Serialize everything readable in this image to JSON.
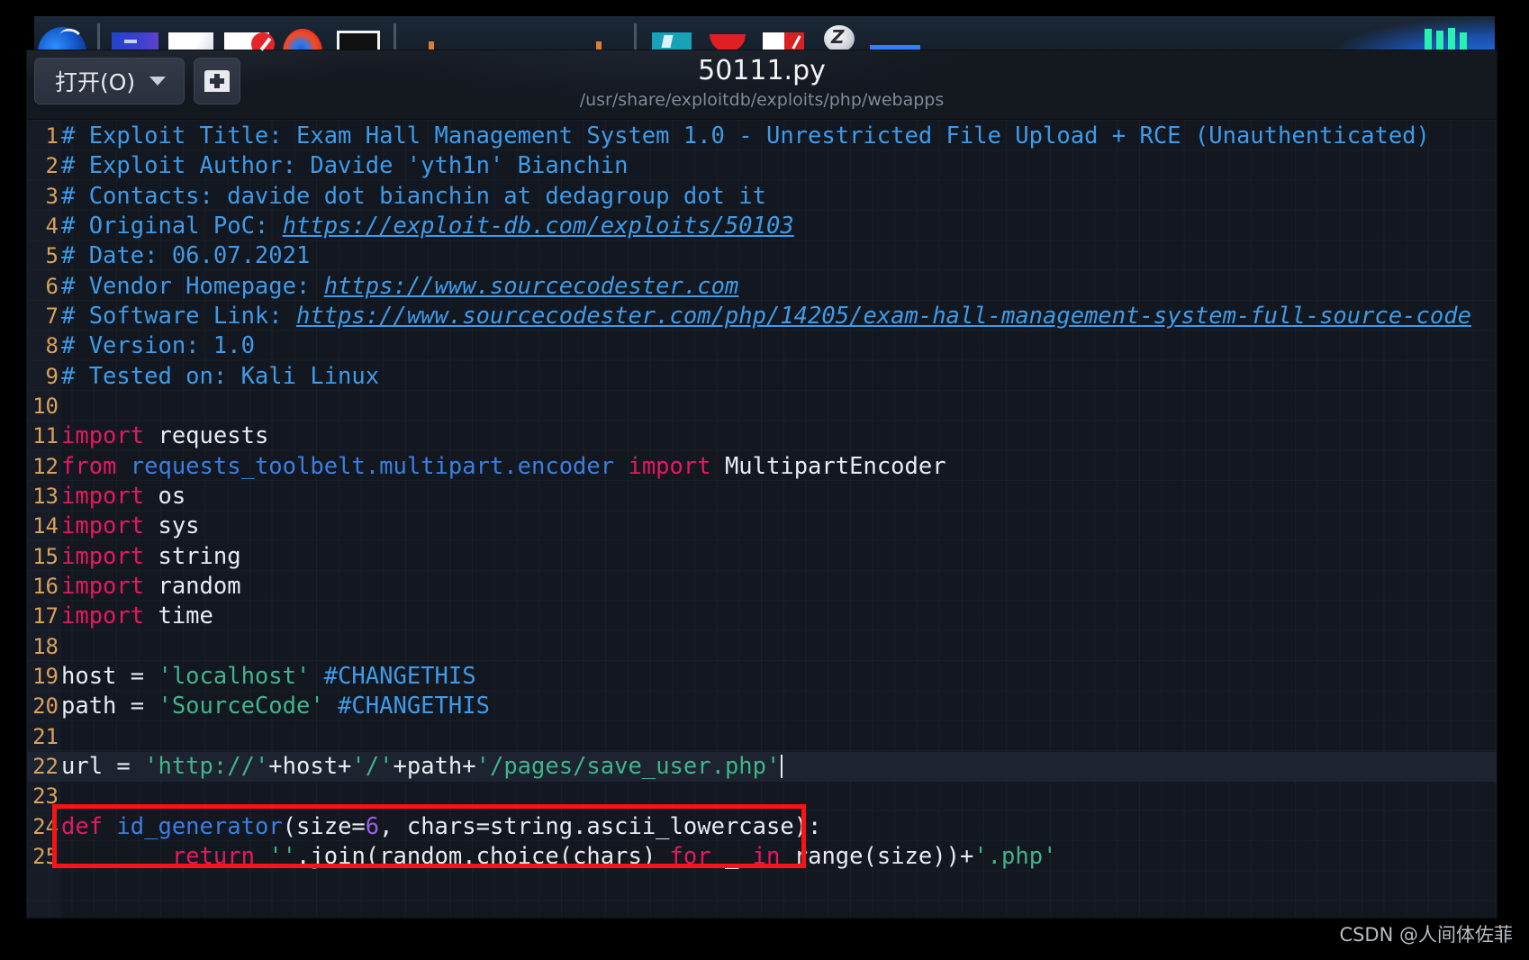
{
  "window": {
    "doc_title": "50111.py",
    "doc_path": "/usr/share/exploitdb/exploits/php/webapps"
  },
  "toolbar": {
    "open_label": "打开(O)",
    "open_icon": "chevron-down-icon",
    "newtab_icon": "new-document-icon"
  },
  "dock": {
    "items": [
      {
        "icon": "kali-menu-icon"
      },
      {
        "icon": "terminal-icon"
      },
      {
        "icon": "file-manager-icon"
      },
      {
        "icon": "text-editor-icon"
      },
      {
        "icon": "firefox-icon"
      },
      {
        "icon": "terminal-window-icon"
      },
      {
        "icon": "workspace-1-icon"
      },
      {
        "icon": "workspace-2-icon"
      },
      {
        "icon": "workspace-3-icon"
      },
      {
        "icon": "workspace-4-icon"
      },
      {
        "icon": "burp-suite-icon"
      },
      {
        "icon": "red-app-icon"
      },
      {
        "icon": "pdf-reader-icon"
      },
      {
        "icon": "zoom-icon"
      },
      {
        "icon": "blue-bar-icon"
      },
      {
        "icon": "cpu-monitor-icon"
      }
    ]
  },
  "editor": {
    "current_line": 22,
    "cursor_line": 22,
    "lines": [
      {
        "n": "1",
        "tokens": [
          {
            "t": "comment",
            "v": "# Exploit Title: Exam Hall Management System 1.0 - Unrestricted File Upload + RCE (Unauthenticated)"
          }
        ]
      },
      {
        "n": "2",
        "tokens": [
          {
            "t": "comment",
            "v": "# Exploit Author: Davide 'yth1n' Bianchin"
          }
        ]
      },
      {
        "n": "3",
        "tokens": [
          {
            "t": "comment",
            "v": "# Contacts: davide dot bianchin at dedagroup dot it"
          }
        ]
      },
      {
        "n": "4",
        "tokens": [
          {
            "t": "comment",
            "v": "# Original PoC: "
          },
          {
            "t": "link",
            "v": "https://exploit-db.com/exploits/50103"
          }
        ]
      },
      {
        "n": "5",
        "tokens": [
          {
            "t": "comment",
            "v": "# Date: 06.07.2021"
          }
        ]
      },
      {
        "n": "6",
        "tokens": [
          {
            "t": "comment",
            "v": "# Vendor Homepage: "
          },
          {
            "t": "link",
            "v": "https://www.sourcecodester.com"
          }
        ]
      },
      {
        "n": "7",
        "tokens": [
          {
            "t": "comment",
            "v": "# Software Link: "
          },
          {
            "t": "link",
            "v": "https://www.sourcecodester.com/php/14205/exam-hall-management-system-full-source-code"
          }
        ]
      },
      {
        "n": "8",
        "tokens": [
          {
            "t": "comment",
            "v": "# Version: 1.0"
          }
        ]
      },
      {
        "n": "9",
        "tokens": [
          {
            "t": "comment",
            "v": "# Tested on: Kali Linux"
          }
        ]
      },
      {
        "n": "10",
        "tokens": []
      },
      {
        "n": "11",
        "tokens": [
          {
            "t": "kw",
            "v": "import"
          },
          {
            "t": "plain",
            "v": " requests"
          }
        ]
      },
      {
        "n": "12",
        "tokens": [
          {
            "t": "kw",
            "v": "from"
          },
          {
            "t": "mod",
            "v": " requests_toolbelt.multipart.encoder "
          },
          {
            "t": "kw",
            "v": "import"
          },
          {
            "t": "plain",
            "v": " MultipartEncoder"
          }
        ]
      },
      {
        "n": "13",
        "tokens": [
          {
            "t": "kw",
            "v": "import"
          },
          {
            "t": "plain",
            "v": " os"
          }
        ]
      },
      {
        "n": "14",
        "tokens": [
          {
            "t": "kw",
            "v": "import"
          },
          {
            "t": "plain",
            "v": " sys"
          }
        ]
      },
      {
        "n": "15",
        "tokens": [
          {
            "t": "kw",
            "v": "import"
          },
          {
            "t": "plain",
            "v": " string"
          }
        ]
      },
      {
        "n": "16",
        "tokens": [
          {
            "t": "kw",
            "v": "import"
          },
          {
            "t": "plain",
            "v": " random"
          }
        ]
      },
      {
        "n": "17",
        "tokens": [
          {
            "t": "kw",
            "v": "import"
          },
          {
            "t": "plain",
            "v": " time"
          }
        ]
      },
      {
        "n": "18",
        "tokens": []
      },
      {
        "n": "19",
        "tokens": [
          {
            "t": "plain",
            "v": "host = "
          },
          {
            "t": "str",
            "v": "'localhost'"
          },
          {
            "t": "plain",
            "v": " "
          },
          {
            "t": "comment",
            "v": "#CHANGETHIS"
          }
        ]
      },
      {
        "n": "20",
        "tokens": [
          {
            "t": "plain",
            "v": "path = "
          },
          {
            "t": "str",
            "v": "'SourceCode'"
          },
          {
            "t": "plain",
            "v": " "
          },
          {
            "t": "comment",
            "v": "#CHANGETHIS"
          }
        ]
      },
      {
        "n": "21",
        "tokens": []
      },
      {
        "n": "22",
        "tokens": [
          {
            "t": "plain",
            "v": "url = "
          },
          {
            "t": "str",
            "v": "'http://'"
          },
          {
            "t": "plain",
            "v": "+host+"
          },
          {
            "t": "str",
            "v": "'/'"
          },
          {
            "t": "plain",
            "v": "+path+"
          },
          {
            "t": "str",
            "v": "'/pages/save_user.php'"
          },
          {
            "t": "caret",
            "v": ""
          }
        ]
      },
      {
        "n": "23",
        "tokens": []
      },
      {
        "n": "24",
        "tokens": [
          {
            "t": "kw",
            "v": "def"
          },
          {
            "t": "fn",
            "v": " id_generator"
          },
          {
            "t": "plain",
            "v": "(size="
          },
          {
            "t": "num",
            "v": "6"
          },
          {
            "t": "plain",
            "v": ", chars=string.ascii_lowercase):"
          }
        ]
      },
      {
        "n": "25",
        "tokens": [
          {
            "t": "plain",
            "v": "        "
          },
          {
            "t": "kw",
            "v": "return"
          },
          {
            "t": "plain",
            "v": " "
          },
          {
            "t": "str",
            "v": "''"
          },
          {
            "t": "plain",
            "v": ".join(random.choice(chars) "
          },
          {
            "t": "kw",
            "v": "for"
          },
          {
            "t": "plain",
            "v": " _ "
          },
          {
            "t": "kw",
            "v": "in"
          },
          {
            "t": "plain",
            "v": " range(size))+"
          },
          {
            "t": "str",
            "v": "'.php'"
          }
        ]
      }
    ]
  },
  "annotation": {
    "type": "red-rectangle-highlight",
    "color": "#f81414",
    "covers_lines": "22-23"
  },
  "watermark": {
    "text": "CSDN @人间体佐菲"
  },
  "colors": {
    "background": "#131720",
    "comment": "#3d9be9",
    "keyword": "#e5195e",
    "string": "#3fb58a",
    "function": "#3b7fe0",
    "number": "#9a5fe8",
    "plain": "#e8ebf0",
    "line_number": "#d9a15c",
    "current_line_bg": "#1d2330",
    "annotation": "#f81414"
  }
}
